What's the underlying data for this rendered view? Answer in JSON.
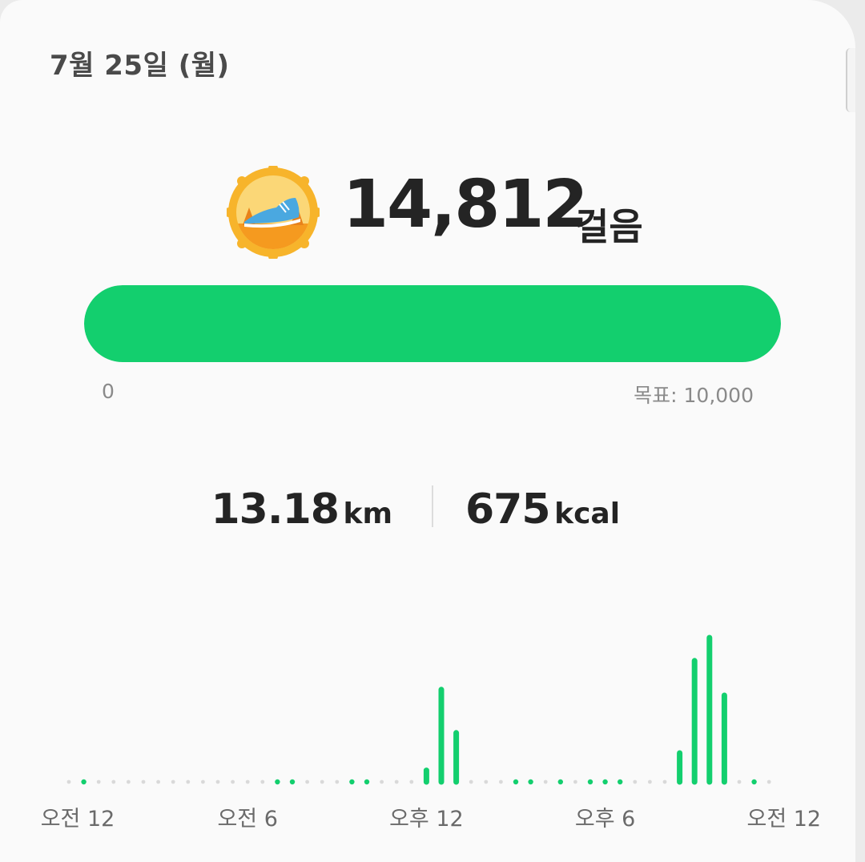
{
  "date": "7월 25일 (월)",
  "badge_icon": "running-shoe-badge-icon",
  "steps": {
    "value": "14,812",
    "unit": "걸음"
  },
  "progress": {
    "fraction": 1.0,
    "min_label": "0",
    "goal_label": "목표: 10,000",
    "fill_color": "#13cf6e"
  },
  "stats": {
    "distance": {
      "value": "13.18",
      "unit": "km"
    },
    "calories": {
      "value": "675",
      "unit": "kcal"
    }
  },
  "colors": {
    "accent": "#13cf6e",
    "idle_dot": "#d9d9d9"
  },
  "chart_data": {
    "type": "bar",
    "xlabel": "",
    "ylabel": "",
    "x_tick_labels": [
      "오전 12",
      "오전 6",
      "오후 12",
      "오후 6",
      "오전 12"
    ],
    "bins_per_day": 48,
    "ylim": [
      0,
      10
    ],
    "values": [
      0,
      0.2,
      0,
      0,
      0,
      0,
      0,
      0,
      0,
      0,
      0,
      0,
      0,
      0,
      0.2,
      0.2,
      0,
      0,
      0,
      0.2,
      0.2,
      0,
      0,
      0,
      0.8,
      6.4,
      3.4,
      0,
      0,
      0,
      0.2,
      0.2,
      0,
      0.2,
      0,
      0.2,
      0.2,
      0.2,
      0,
      0,
      0,
      2,
      8.4,
      10,
      6,
      0,
      0.2,
      0
    ]
  }
}
